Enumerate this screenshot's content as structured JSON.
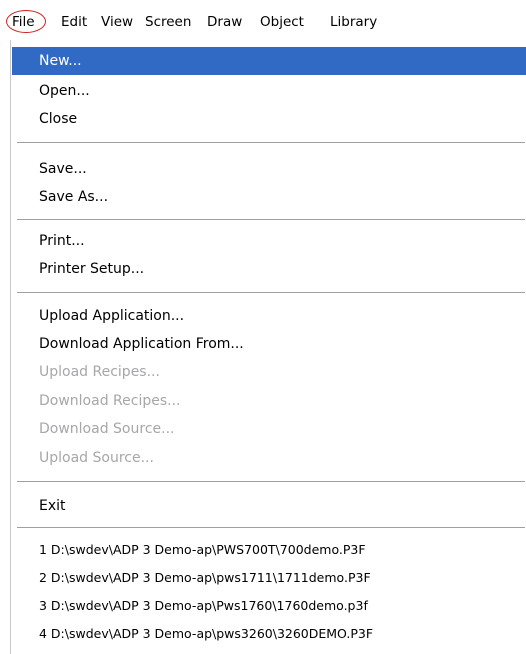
{
  "menubar": {
    "items": [
      "File",
      "Edit",
      "View",
      "Screen",
      "Draw",
      "Object",
      "Library"
    ]
  },
  "file_menu": {
    "items": [
      {
        "label": "New...",
        "state": "selected"
      },
      {
        "label": "Open...",
        "state": "enabled"
      },
      {
        "label": "Close",
        "state": "enabled"
      },
      {
        "label": "Save...",
        "state": "enabled"
      },
      {
        "label": "Save As...",
        "state": "enabled"
      },
      {
        "label": "Print...",
        "state": "enabled"
      },
      {
        "label": "Printer Setup...",
        "state": "enabled"
      },
      {
        "label": "Upload Application...",
        "state": "enabled"
      },
      {
        "label": "Download Application From...",
        "state": "enabled"
      },
      {
        "label": "Upload Recipes...",
        "state": "disabled"
      },
      {
        "label": "Download Recipes...",
        "state": "disabled"
      },
      {
        "label": "Download Source...",
        "state": "disabled"
      },
      {
        "label": "Upload Source...",
        "state": "disabled"
      },
      {
        "label": "Exit",
        "state": "enabled"
      }
    ],
    "recent_files": [
      "1 D:\\swdev\\ADP 3 Demo-ap\\PWS700T\\700demo.P3F",
      "2 D:\\swdev\\ADP 3 Demo-ap\\pws1711\\1711demo.P3F",
      "3 D:\\swdev\\ADP 3 Demo-ap\\Pws1760\\1760demo.p3f",
      "4 D:\\swdev\\ADP 3 Demo-ap\\pws3260\\3260DEMO.P3F"
    ]
  },
  "colors": {
    "selection": "#316ac5",
    "disabled_text": "#a7a6aa",
    "highlight_circle": "#d02020"
  }
}
